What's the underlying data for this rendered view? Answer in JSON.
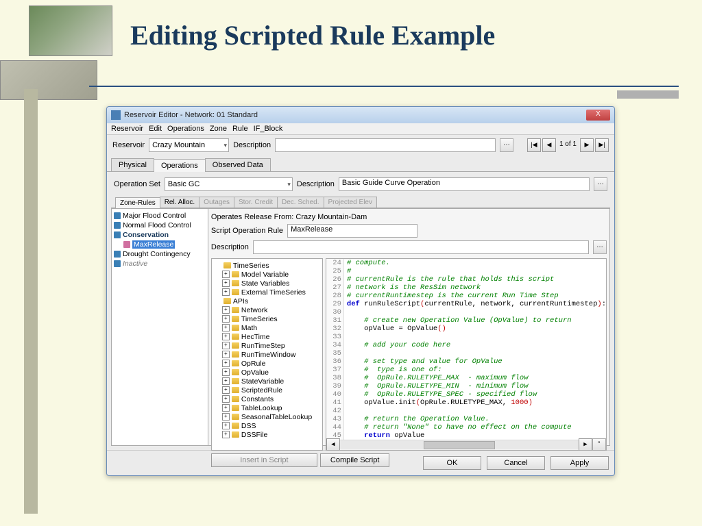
{
  "slide": {
    "title": "Editing Scripted Rule Example"
  },
  "window": {
    "title": "Reservoir Editor - Network: 01 Standard",
    "close": "X",
    "menu": [
      "Reservoir",
      "Edit",
      "Operations",
      "Zone",
      "Rule",
      "IF_Block"
    ],
    "reservoir_lbl": "Reservoir",
    "reservoir": "Crazy Mountain",
    "desc_lbl": "Description",
    "nav": {
      "first": "|◀",
      "prev": "◀",
      "text": "1 of 1",
      "next": "▶",
      "last": "▶|"
    },
    "tabs": [
      "Physical",
      "Operations",
      "Observed Data"
    ],
    "opset_lbl": "Operation Set",
    "opset": "Basic GC",
    "opset_desc_lbl": "Description",
    "opset_desc": "Basic Guide Curve Operation",
    "subtabs": [
      "Zone-Rules",
      "Rel. Alloc.",
      "Outages",
      "Stor. Credit",
      "Dec. Sched.",
      "Projected Elev"
    ],
    "zones": {
      "items": [
        {
          "label": "Major Flood Control"
        },
        {
          "label": "Normal Flood Control"
        },
        {
          "label": "Conservation",
          "bold": true
        },
        {
          "label": "MaxRelease",
          "indent": true,
          "selected": true,
          "pink": true
        },
        {
          "label": "Drought Contingency"
        },
        {
          "label": "Inactive",
          "italic": true
        }
      ]
    },
    "operates_lbl": "Operates Release From: Crazy Mountain-Dam",
    "script_rule_lbl": "Script Operation Rule",
    "script_rule": "MaxRelease",
    "rule_desc_lbl": "Description",
    "api": {
      "root": [
        "TimeSeries",
        "APIs"
      ],
      "ts_children": [
        "Model Variable",
        "State Variables",
        "External TimeSeries"
      ],
      "api_children": [
        "Network",
        "TimeSeries",
        "Math",
        "HecTime",
        "RunTimeStep",
        "RunTimeWindow",
        "OpRule",
        "OpValue",
        "StateVariable",
        "ScriptedRule",
        "Constants",
        "TableLookup",
        "SeasonalTableLookup",
        "DSS",
        "DSSFile"
      ]
    },
    "insert_btn": "Insert in Script",
    "compile_btn": "Compile Script",
    "ok": "OK",
    "cancel": "Cancel",
    "apply": "Apply"
  },
  "code": {
    "lines": [
      {
        "n": 24,
        "t": "# compute.",
        "cls": "c-comment"
      },
      {
        "n": 25,
        "t": "#",
        "cls": "c-comment"
      },
      {
        "n": 26,
        "t": "# currentRule is the rule that holds this script",
        "cls": "c-comment"
      },
      {
        "n": 27,
        "t": "# network is the ResSim network",
        "cls": "c-comment"
      },
      {
        "n": 28,
        "t": "# currentRuntimestep is the current Run Time Step",
        "cls": "c-comment"
      },
      {
        "n": 29,
        "html": "<span class='c-kw'>def</span> runRuleScript<span class='c-paren'>(</span>currentRule, network, currentRuntimestep<span class='c-paren'>)</span>:"
      },
      {
        "n": 30,
        "t": ""
      },
      {
        "n": 31,
        "t": "    # create new Operation Value (OpValue) to return",
        "cls": "c-comment"
      },
      {
        "n": 32,
        "html": "    opValue = OpValue<span class='c-paren'>()</span>"
      },
      {
        "n": 33,
        "t": ""
      },
      {
        "n": 34,
        "t": "    # add your code here",
        "cls": "c-comment"
      },
      {
        "n": 35,
        "t": ""
      },
      {
        "n": 36,
        "t": "    # set type and value for OpValue",
        "cls": "c-comment"
      },
      {
        "n": 37,
        "t": "    #  type is one of:",
        "cls": "c-comment"
      },
      {
        "n": 38,
        "t": "    #  OpRule.RULETYPE_MAX  - maximum flow",
        "cls": "c-comment"
      },
      {
        "n": 39,
        "t": "    #  OpRule.RULETYPE_MIN  - minimum flow",
        "cls": "c-comment"
      },
      {
        "n": 40,
        "t": "    #  OpRule.RULETYPE_SPEC - specified flow",
        "cls": "c-comment"
      },
      {
        "n": 41,
        "html": "    opValue.init<span class='c-paren'>(</span>OpRule.RULETYPE_MAX, <span class='c-num'>1000</span><span class='c-paren'>)</span>"
      },
      {
        "n": 42,
        "t": ""
      },
      {
        "n": 43,
        "t": "    # return the Operation Value.",
        "cls": "c-comment"
      },
      {
        "n": 44,
        "t": "    # return \"None\" to have no effect on the compute",
        "cls": "c-comment"
      },
      {
        "n": 45,
        "html": "    <span class='c-kw'>return</span> opValue"
      }
    ]
  }
}
